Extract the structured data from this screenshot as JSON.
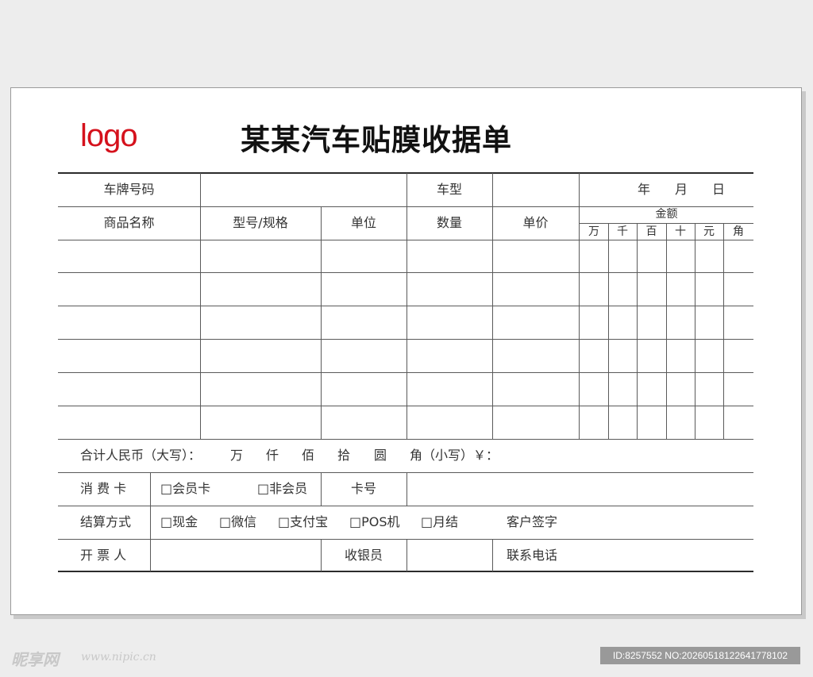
{
  "logo": "logo",
  "title": "某某汽车贴膜收据单",
  "header": {
    "plate_label": "车牌号码",
    "model_label": "车型",
    "year": "年",
    "month": "月",
    "day": "日"
  },
  "columns": {
    "product": "商品名称",
    "spec": "型号/规格",
    "unit": "单位",
    "qty": "数量",
    "price": "单价",
    "amount": "金额",
    "amount_units": [
      "万",
      "千",
      "百",
      "十",
      "元",
      "角"
    ]
  },
  "total": {
    "label": "合计人民币（大写）：",
    "units": [
      "万",
      "仟",
      "佰",
      "拾",
      "圆",
      "角（小写）￥："
    ]
  },
  "card": {
    "label": "消  费  卡",
    "member": "□会员卡",
    "non_member": "□非会员",
    "card_no": "卡号"
  },
  "payment": {
    "label": "结算方式",
    "options": [
      "□现金",
      "□微信",
      "□支付宝",
      "□POS机",
      "□月结"
    ],
    "customer_sign": "客户签字"
  },
  "footer": {
    "issuer": "开  票  人",
    "cashier": "收银员",
    "phone": "联系电话"
  },
  "watermark": {
    "site": "昵享网",
    "url": "www.nipic.cn",
    "id": "ID:8257552 NO:20260518122641778102"
  }
}
